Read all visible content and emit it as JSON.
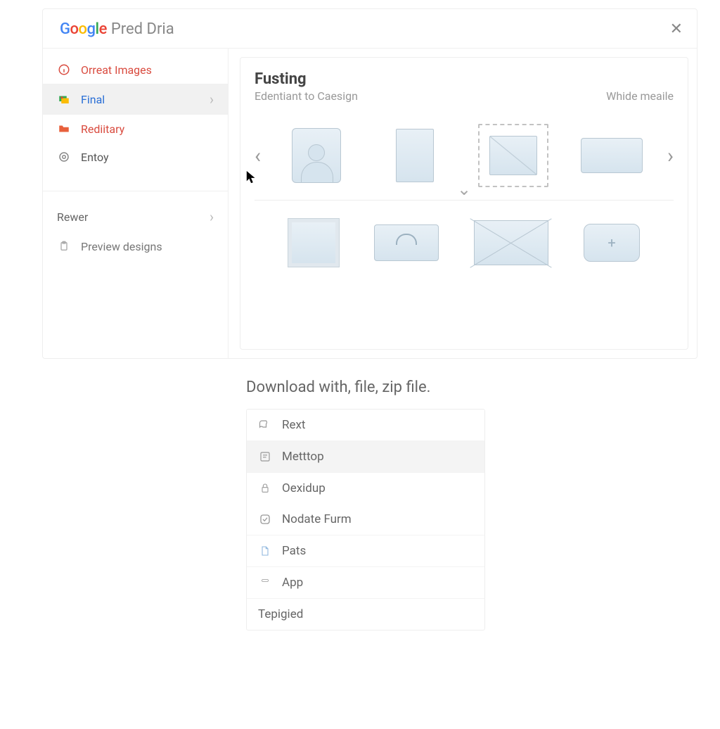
{
  "header": {
    "brand": "Google",
    "title": "Pred Dria"
  },
  "sidebar": {
    "items": [
      {
        "label": "Orreat Images"
      },
      {
        "label": "Final"
      },
      {
        "label": "Rediitary"
      },
      {
        "label": "Entoy"
      }
    ],
    "section2": {
      "heading": "Rewer",
      "item": "Preview designs"
    }
  },
  "content": {
    "title": "Fusting",
    "subtitle": "Edentiant to Caesign",
    "right_hint": "Whide meaile"
  },
  "download": {
    "heading": "Download with, file, zip file.",
    "items": [
      {
        "label": "Rext"
      },
      {
        "label": "Metttop"
      },
      {
        "label": "Oexidup"
      },
      {
        "label": "Nodate Furm"
      },
      {
        "label": "Pats"
      },
      {
        "label": "App"
      },
      {
        "label": "Tepigied"
      }
    ]
  }
}
